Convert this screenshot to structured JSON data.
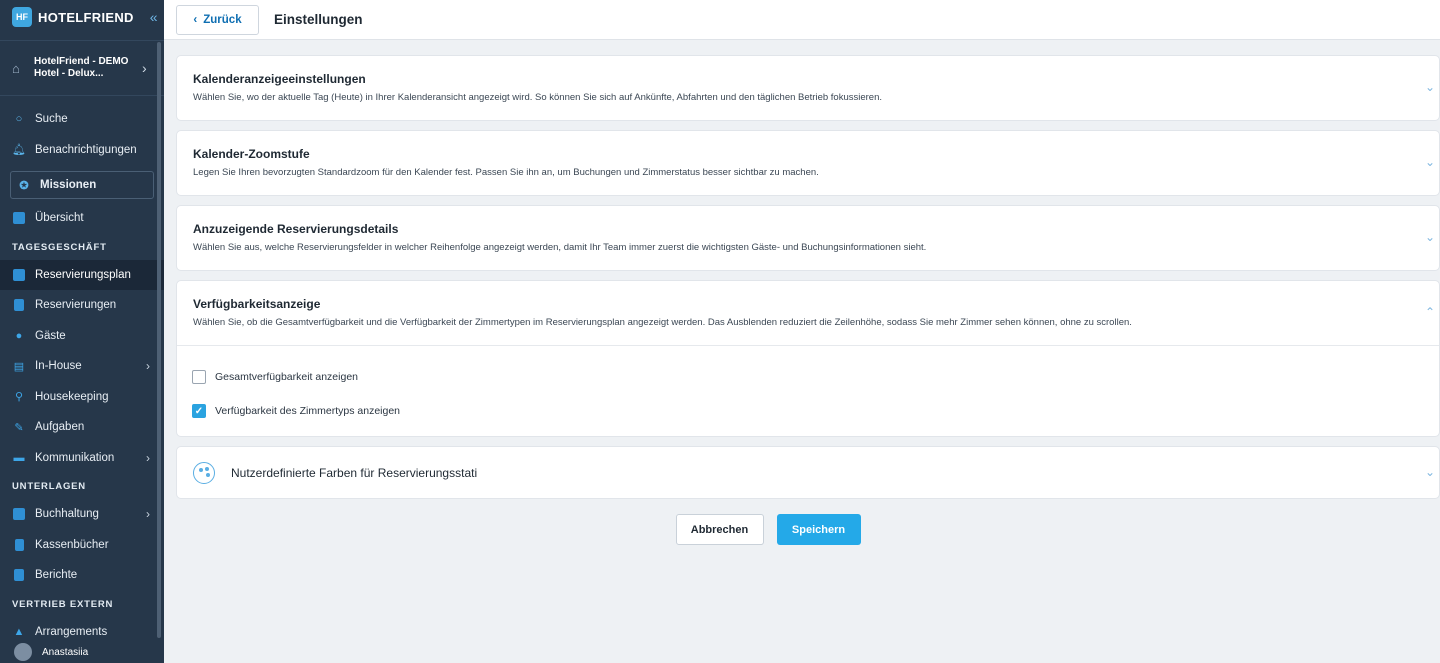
{
  "brand": {
    "name": "HOTELFRIEND",
    "logo_text": "HF"
  },
  "hotel": {
    "line1": "HotelFriend - DEMO",
    "line2": "Hotel - Delux..."
  },
  "nav": {
    "search": "Suche",
    "notifications": "Benachrichtigungen",
    "missions": "Missionen",
    "overview": "Übersicht",
    "section_daily": "TAGESGESCHÄFT",
    "reservation_plan": "Reservierungsplan",
    "reservations": "Reservierungen",
    "guests": "Gäste",
    "inhouse": "In-House",
    "housekeeping": "Housekeeping",
    "tasks": "Aufgaben",
    "communication": "Kommunikation",
    "section_docs": "UNTERLAGEN",
    "accounting": "Buchhaltung",
    "cashbooks": "Kassenbücher",
    "reports": "Berichte",
    "section_sales": "VERTRIEB EXTERN",
    "arrangements": "Arrangements"
  },
  "user": {
    "name": "Anastasiia"
  },
  "topbar": {
    "back_label": "Zurück",
    "title": "Einstellungen"
  },
  "cards": [
    {
      "title": "Kalenderanzeigeeinstellungen",
      "desc": "Wählen Sie, wo der aktuelle Tag (Heute) in Ihrer Kalenderansicht angezeigt wird. So können Sie sich auf Ankünfte, Abfahrten und den täglichen Betrieb fokussieren."
    },
    {
      "title": "Kalender-Zoomstufe",
      "desc": "Legen Sie Ihren bevorzugten Standardzoom für den Kalender fest. Passen Sie ihn an, um Buchungen und Zimmerstatus besser sichtbar zu machen."
    },
    {
      "title": "Anzuzeigende Reservierungsdetails",
      "desc": "Wählen Sie aus, welche Reservierungsfelder in welcher Reihenfolge angezeigt werden, damit Ihr Team immer zuerst die wichtigsten Gäste- und Buchungsinformationen sieht."
    },
    {
      "title": "Verfügbarkeitsanzeige",
      "desc": "Wählen Sie, ob die Gesamtverfügbarkeit und die Verfügbarkeit der Zimmertypen im Reservierungsplan angezeigt werden. Das Ausblenden reduziert die Zeilenhöhe, sodass Sie mehr Zimmer sehen können, ohne zu scrollen."
    }
  ],
  "availability": {
    "total_label": "Gesamtverfügbarkeit anzeigen",
    "total_checked": false,
    "roomtype_label": "Verfügbarkeit des Zimmertyps anzeigen",
    "roomtype_checked": true
  },
  "colors_card": {
    "title": "Nutzerdefinierte Farben für Reservierungsstati",
    "icon": "palette-icon"
  },
  "actions": {
    "cancel": "Abbrechen",
    "save": "Speichern"
  },
  "theme": {
    "sidebar_bg": "#26374a",
    "accent": "#24a9e8",
    "link": "#0f6fb2"
  }
}
